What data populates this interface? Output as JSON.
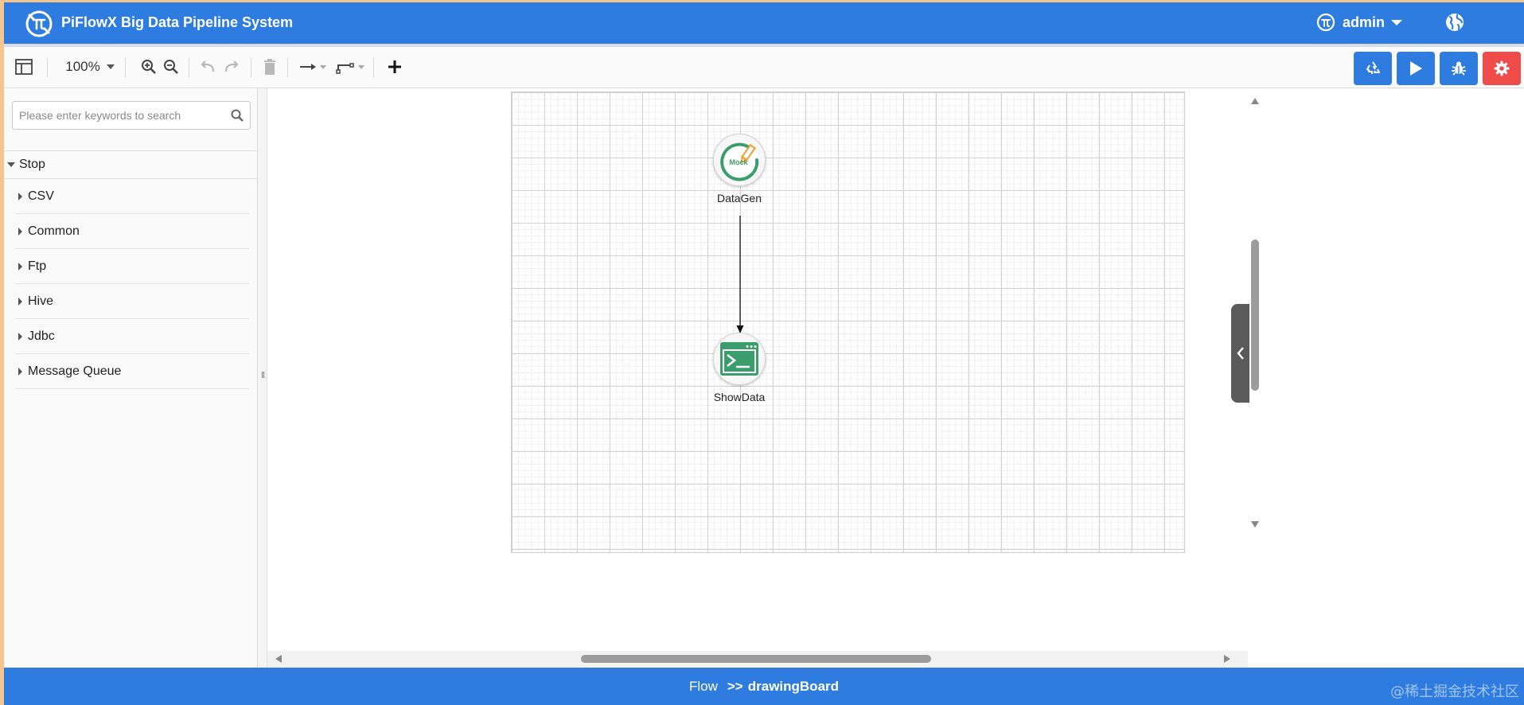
{
  "header": {
    "title": "PiFlowX Big Data Pipeline System",
    "user": "admin",
    "logo_icon": "pi-flow-logo-icon",
    "lang_icon": "globe-icon"
  },
  "toolbar": {
    "zoom": "100%",
    "icons": [
      "format-panel-icon",
      "zoom-in-icon",
      "zoom-out-icon",
      "undo-icon",
      "redo-icon",
      "delete-icon",
      "connection-arrow-icon",
      "waypoint-icon",
      "add-icon"
    ],
    "actions": [
      {
        "name": "recycle-icon",
        "color": "#2e7ce0"
      },
      {
        "name": "run-icon",
        "color": "#2e7ce0"
      },
      {
        "name": "debug-icon",
        "color": "#2e7ce0"
      },
      {
        "name": "settings-icon",
        "color": "#ef4b4b"
      }
    ]
  },
  "sidebar": {
    "search_placeholder": "Please enter keywords to search",
    "group": "Stop",
    "categories": [
      {
        "label": "CSV"
      },
      {
        "label": "Common"
      },
      {
        "label": "Ftp"
      },
      {
        "label": "Hive"
      },
      {
        "label": "Jdbc"
      },
      {
        "label": "Message Queue"
      }
    ]
  },
  "canvas": {
    "nodes": [
      {
        "label": "DataGen",
        "badge": "Mock",
        "icon": "mock-pencil-icon"
      },
      {
        "label": "ShowData",
        "icon": "terminal-icon"
      }
    ]
  },
  "footer": {
    "flow": "Flow",
    "separator": ">>",
    "current": "drawingBoard"
  },
  "watermark": "@稀土掘金技术社区",
  "colors": {
    "primary": "#2e7ce0",
    "danger": "#ef4b4b",
    "node_green": "#3a9e6c",
    "node_orange": "#f29c2b"
  }
}
